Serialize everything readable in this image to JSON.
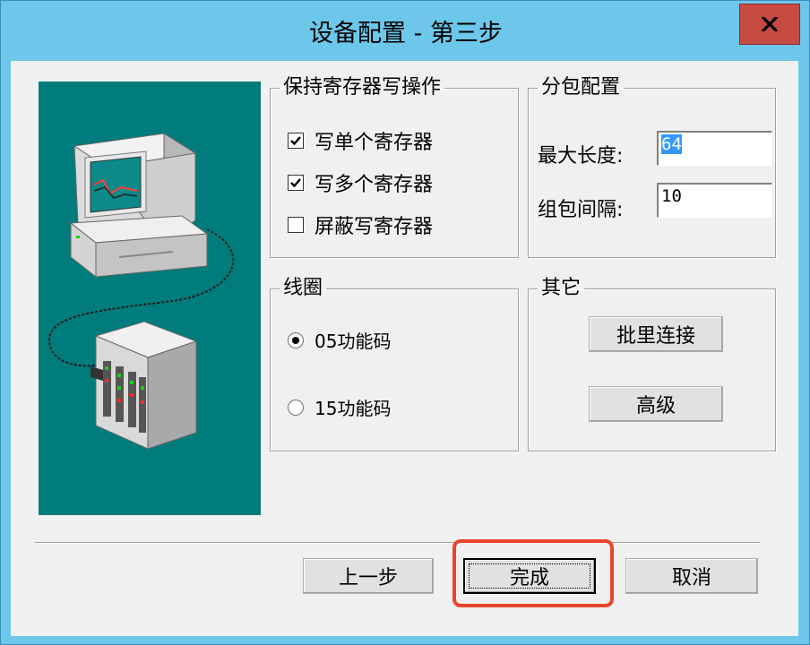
{
  "window": {
    "title": "设备配置 - 第三步",
    "close_label": "x"
  },
  "holding_register_group": {
    "legend": "保持寄存器写操作",
    "options": [
      {
        "label": "写单个寄存器",
        "checked": true
      },
      {
        "label": "写多个寄存器",
        "checked": true
      },
      {
        "label": "屏蔽写寄存器",
        "checked": false
      }
    ]
  },
  "packet_group": {
    "legend": "分包配置",
    "max_length_label": "最大长度:",
    "max_length_value": "64",
    "interval_label": "组包间隔:",
    "interval_value": "10"
  },
  "coil_group": {
    "legend": "线圈",
    "options": [
      {
        "label": "05功能码",
        "selected": true
      },
      {
        "label": "15功能码",
        "selected": false
      }
    ]
  },
  "other_group": {
    "legend": "其它",
    "batch_connect_label": "批里连接",
    "advanced_label": "高级"
  },
  "footer": {
    "prev_label": "上一步",
    "finish_label": "完成",
    "cancel_label": "取消"
  },
  "colors": {
    "title_bar": "#6cc7ea",
    "close_button": "#c74b42",
    "illustration_bg": "#007c7c",
    "highlight": "#e8452a"
  }
}
